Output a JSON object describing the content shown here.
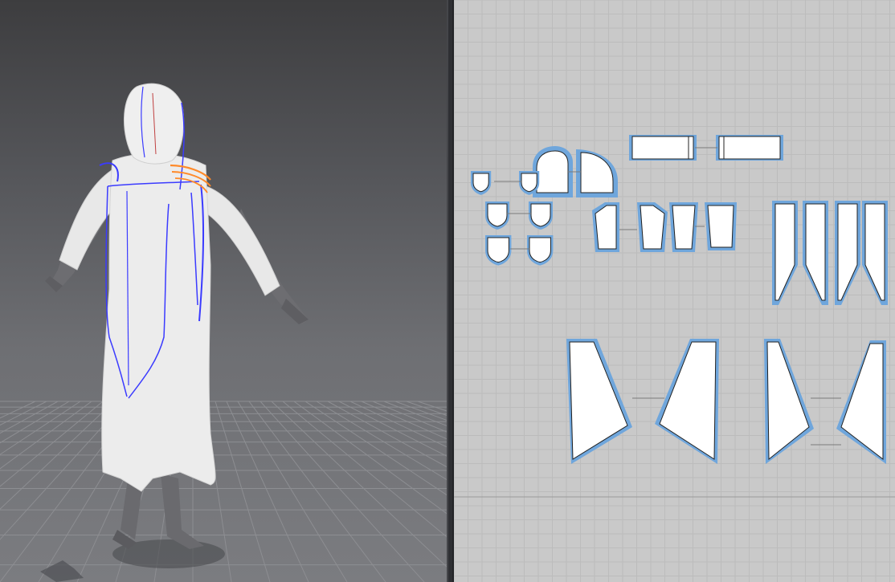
{
  "app": {
    "views": [
      "3d-viewport",
      "2d-pattern-window"
    ],
    "colors": {
      "background_3d": "#5a5b5f",
      "floor_grid": "#8a8b8f",
      "garment": "#ececec",
      "avatar": "#6d6d71",
      "seam_blue": "#3b3bff",
      "seam_orange": "#ff8a2a",
      "pattern_bg": "#c9c9c9",
      "pattern_grid": "#b6b6b6",
      "pattern_piece_fill": "#ffffff",
      "pattern_outline": "#6fa6dc"
    }
  },
  "viewport_3d": {
    "model": "avatar-with-hooded-robe",
    "view": "back-perspective",
    "floor": "grid"
  },
  "pattern_2d": {
    "piece_groups": [
      {
        "name": "hood-pieces",
        "count": 2
      },
      {
        "name": "hood-band-pieces",
        "count": 2
      },
      {
        "name": "small-shield-pieces",
        "count": 6
      },
      {
        "name": "sleeve-top-pieces",
        "count": 4
      },
      {
        "name": "long-panel-pieces",
        "count": 4
      },
      {
        "name": "skirt-left-pieces",
        "count": 2
      },
      {
        "name": "skirt-right-pieces",
        "count": 2
      }
    ]
  }
}
